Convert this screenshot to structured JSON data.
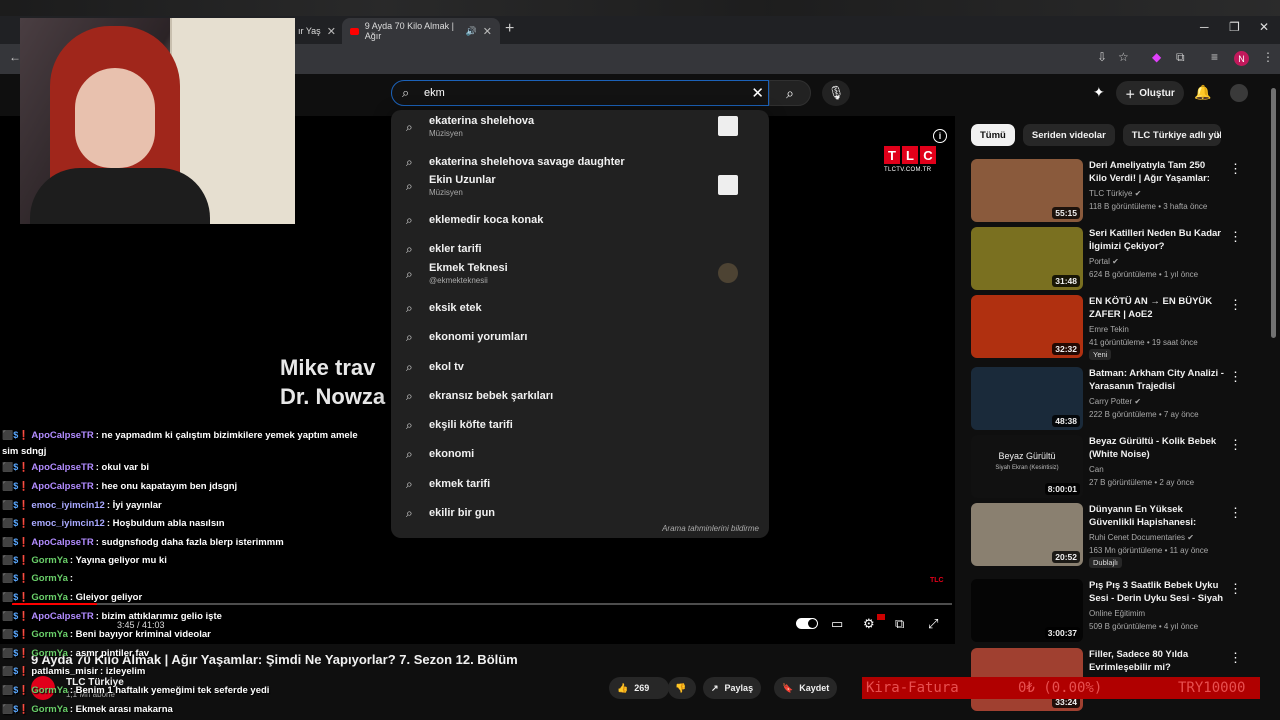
{
  "browser": {
    "tabs": [
      {
        "label": "ır Yaş",
        "active": false
      },
      {
        "label": "9 Ayda 70 Kilo Almak | Ağır",
        "active": true
      }
    ],
    "new_tab": "+",
    "account_initial": "N"
  },
  "header": {
    "search_query": "ekm",
    "create_label": "Oluştur"
  },
  "suggestions": [
    {
      "text": "ekaterina shelehova",
      "sub": "Müzisyen",
      "thumb": "square"
    },
    {
      "text": "ekaterina shelehova savage daughter"
    },
    {
      "text": "Ekin Uzunlar",
      "sub": "Müzisyen",
      "thumb": "square"
    },
    {
      "text": "eklemedir koca konak"
    },
    {
      "text": "ekler tarifi"
    },
    {
      "text": "Ekmek Teknesi",
      "sub": "@ekmekteknesii",
      "thumb": "round"
    },
    {
      "text": "eksik etek"
    },
    {
      "text": "ekonomi yorumları"
    },
    {
      "text": "ekol tv"
    },
    {
      "text": "ekransız bebek şarkıları"
    },
    {
      "text": "ekşili köfte tarifi"
    },
    {
      "text": "ekonomi"
    },
    {
      "text": "ekmek tarifi"
    },
    {
      "text": "ekilir bir gun"
    }
  ],
  "suggestions_footer": "Arama tahminlerini bildirme",
  "video": {
    "overlay_text_line1": "Mike trav",
    "overlay_text_line2": "Dr. Nowza",
    "tlc_letters": [
      "T",
      "L",
      "C"
    ],
    "tlc_url": "TLCTV.COM.TR",
    "time": "3:45 / 41:03",
    "progress": 0.09,
    "title": "9 Ayda 70 Kilo Almak | Ağır Yaşamlar: Şimdi Ne Yapıyorlar? 7. Sezon 12. Bölüm",
    "channel": "TLC Türkiye",
    "subs": "1,1 Mn abone",
    "likes": "269",
    "share_label": "Paylaş",
    "save_label": "Kaydet"
  },
  "chat": [
    {
      "user": "ApoCalpseTR",
      "msg": ": ne yapmadım ki çalıştım bizimkilere yemek yaptım amele",
      "color": "#b28cff"
    },
    {
      "user": "",
      "msg": "sim sdngj",
      "color": "#fff"
    },
    {
      "user": "ApoCalpseTR",
      "msg": ": okul var bi",
      "color": "#b28cff"
    },
    {
      "user": "ApoCalpseTR",
      "msg": ": hee onu kapatayım ben jdsgnj",
      "color": "#b28cff"
    },
    {
      "user": "emoc_iyimcin12",
      "msg": ": İyi yayınlar",
      "color": "#a9a9ff"
    },
    {
      "user": "emoc_iyimcin12",
      "msg": ": Hoşbuldum abla nasılsın",
      "color": "#a9a9ff"
    },
    {
      "user": "ApoCalpseTR",
      "msg": ": sudgnsfıodg daha fazla blerp isterimmm",
      "color": "#b28cff"
    },
    {
      "user": "GormYa",
      "msg": ": Yayına geliyor mu ki",
      "color": "#6ad06a"
    },
    {
      "user": "GormYa",
      "msg": ":",
      "color": "#6ad06a"
    },
    {
      "user": "GormYa",
      "msg": ": Gleiyor geliyor",
      "color": "#6ad06a"
    },
    {
      "user": "ApoCalpseTR",
      "msg": ": bizim attıklarımız gelio işte",
      "color": "#b28cff"
    },
    {
      "user": "GormYa",
      "msg": ": Beni bayıyor kriminal videolar",
      "color": "#6ad06a"
    },
    {
      "user": "GormYa",
      "msg": ": asmr pintiler fav",
      "color": "#6ad06a"
    },
    {
      "user": "patlamis_misir",
      "msg": ": izleyelim",
      "color": "#ffffff"
    },
    {
      "user": "GormYa",
      "msg": ": Benim 1 haftalık yemeğimi tek seferde yedi",
      "color": "#6ad06a"
    },
    {
      "user": "GormYa",
      "msg": ": Ekmek arası makarna",
      "color": "#6ad06a"
    }
  ],
  "chips": [
    "Tümü",
    "Seriden videolar",
    "TLC Türkiye adlı yükle"
  ],
  "recommendations": [
    {
      "title": "Deri Ameliyatıyla Tam 250 Kilo Verdi! | Ağır Yaşamlar: Şimdi N...",
      "channel": "TLC Türkiye ✔",
      "meta": "118 B görüntüleme • 3 hafta önce",
      "duration": "55:15",
      "bg": "#8a5a3c"
    },
    {
      "title": "Seri Katilleri Neden Bu Kadar İlgimizi Çekiyor?",
      "channel": "Portal ✔",
      "meta": "624 B görüntüleme • 1 yıl önce",
      "duration": "31:48",
      "bg": "#7a7020"
    },
    {
      "title": "EN KÖTÜ AN → EN BÜYÜK ZAFER | AoE2",
      "channel": "Emre Tekin",
      "meta": "41 görüntüleme • 19 saat önce",
      "duration": "32:32",
      "badge": "Yeni",
      "bg": "#b03010"
    },
    {
      "title": "Batman: Arkham City Analizi - Yarasanın Trajedisi",
      "channel": "Carry Potter ✔",
      "meta": "222 B görüntüleme • 7 ay önce",
      "duration": "48:38",
      "bg": "#1a2a3a"
    },
    {
      "title": "Beyaz Gürültü - Kolik Bebek (White Noise)",
      "channel": "Can",
      "meta": "27 B görüntüleme • 2 ay önce",
      "duration": "8:00:01",
      "bg": "#111111",
      "thumb_text": "Beyaz Gürültü",
      "thumb_sub": "Siyah Ekran (Kesintisiz)"
    },
    {
      "title": "Dünyanın En Yüksek Güvenlikli Hapishanesi: CECOT (Şeytanla...",
      "channel": "Ruhi Cenet Documentaries ✔",
      "meta": "163 Mn görüntüleme • 11 ay önce",
      "duration": "20:52",
      "badge": "Dublajlı",
      "bg": "#8a8070"
    },
    {
      "title": "Pış Pış 3 Saatlik Bebek Uyku Sesi - Derin Uyku Sesi - Siyah ...",
      "channel": "Online Eğitimim",
      "meta": "509 B görüntüleme • 4 yıl önce",
      "duration": "3:00:37",
      "bg": "#050505"
    },
    {
      "title": "Filler, Sadece 80 Yılda Evrimleşebilir mi?",
      "channel": "",
      "meta": "",
      "duration": "33:24",
      "bg": "#a04030"
    }
  ],
  "ticker": {
    "left": "Kira-Fatura",
    "mid": "0₺ (0.00%)",
    "right": "TRY10000"
  }
}
